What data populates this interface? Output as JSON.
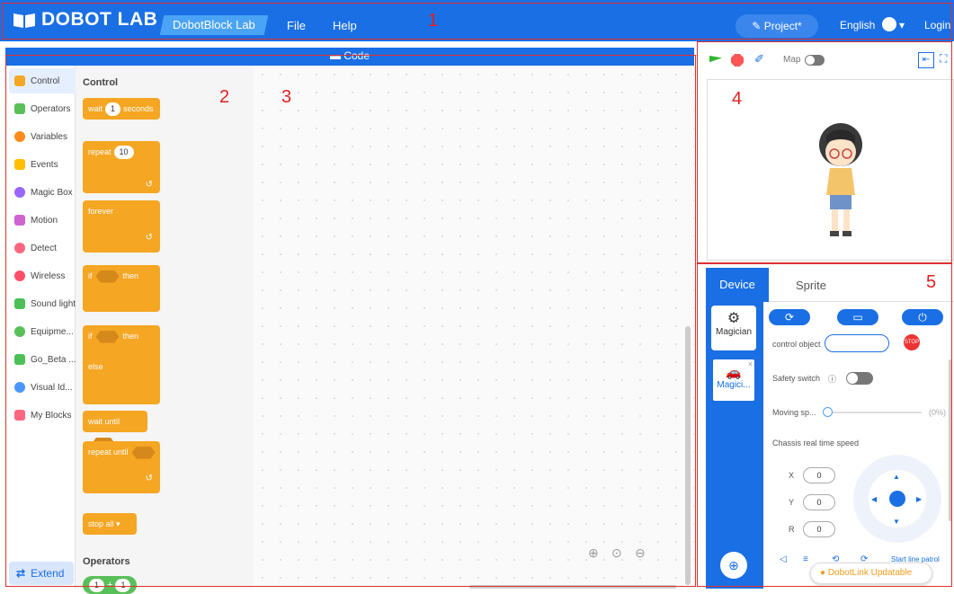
{
  "header": {
    "brand": "DOBOT LAB",
    "product": "DobotBlock Lab",
    "menu": [
      "File",
      "Help"
    ],
    "project": "Project*",
    "language": "English",
    "login": "Login"
  },
  "annotations": [
    "1",
    "2",
    "3",
    "4",
    "5"
  ],
  "code_bar": {
    "title": "Code"
  },
  "categories": [
    {
      "label": "Control",
      "color": "#f5a623"
    },
    {
      "label": "Operators",
      "color": "#59c059"
    },
    {
      "label": "Variables",
      "color": "#ff8c1a"
    },
    {
      "label": "Events",
      "color": "#ffbf00"
    },
    {
      "label": "Magic Box",
      "color": "#9966ff"
    },
    {
      "label": "Motion",
      "color": "#cf63cf"
    },
    {
      "label": "Detect",
      "color": "#ff6680"
    },
    {
      "label": "Wireless",
      "color": "#ff4d6a"
    },
    {
      "label": "Sound light",
      "color": "#4cbf56"
    },
    {
      "label": "Equipme...",
      "color": "#59c059"
    },
    {
      "label": "Go_Beta ...",
      "color": "#4cbf56"
    },
    {
      "label": "Visual Id...",
      "color": "#4c97ff"
    },
    {
      "label": "My Blocks",
      "color": "#ff6680"
    }
  ],
  "extend": "Extend",
  "flyout": {
    "heading": "Control",
    "heading2": "Operators",
    "wait": "wait",
    "wait_val": "1",
    "seconds": "seconds",
    "repeat": "repeat",
    "repeat_val": "10",
    "forever": "forever",
    "if": "if",
    "then": "then",
    "else": "else",
    "wait_until": "wait until",
    "repeat_until": "repeat until",
    "stop": "stop",
    "stop_val": "all ▾",
    "op_a": "1",
    "op_b": "1"
  },
  "stage": {
    "map_label": "Map"
  },
  "panel": {
    "tabs": [
      "Device",
      "Sprite"
    ],
    "device1": "Magician",
    "device2": "Magici...",
    "control_object": "control object",
    "safety_switch": "Safety switch",
    "moving_speed": "Moving sp...",
    "speed_pct": "(0%)",
    "speed_value": 0,
    "chassis": "Chassis real time speed",
    "x_label": "X",
    "y_label": "Y",
    "r_label": "R",
    "x": "0",
    "y": "0",
    "r": "0",
    "line_patrol": "Start line patrol",
    "link": "DobotLink Updatable"
  },
  "colors": {
    "accent": "#1a6fe4",
    "block": "#f5a623"
  }
}
